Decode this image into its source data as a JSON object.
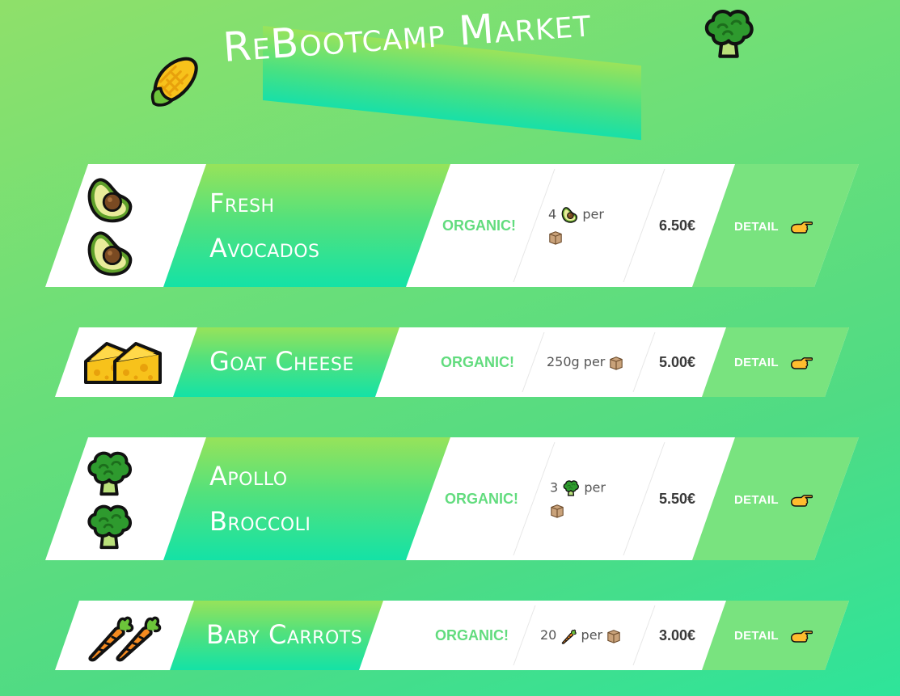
{
  "header": {
    "title": "ReBootcamp Market",
    "left_icon": "corn-icon",
    "right_icon": "broccoli-icon"
  },
  "products": [
    {
      "name_line1": "Fresh",
      "name_line2": "Avocados",
      "tag": "ORGANIC!",
      "qty": "4",
      "qty_icon": "avocado-icon",
      "per": "per",
      "price": "6.50€",
      "detail": "DETAIL"
    },
    {
      "name": "Goat Cheese",
      "tag": "ORGANIC!",
      "qty": "250g",
      "per": "per",
      "price": "5.00€",
      "detail": "DETAIL"
    },
    {
      "name_line1": "Apollo",
      "name_line2": "Broccoli",
      "tag": "ORGANIC!",
      "qty": "3",
      "qty_icon": "broccoli-icon",
      "per": "per",
      "price": "5.50€",
      "detail": "DETAIL"
    },
    {
      "name": "Baby Carrots",
      "tag": "ORGANIC!",
      "qty": "20",
      "qty_icon": "carrot-icon",
      "per": "per",
      "price": "3.00€",
      "detail": "DETAIL"
    }
  ],
  "colors": {
    "organic": "#62dc7e",
    "detail_bg": "#79e37f",
    "title": "#ffffff"
  }
}
